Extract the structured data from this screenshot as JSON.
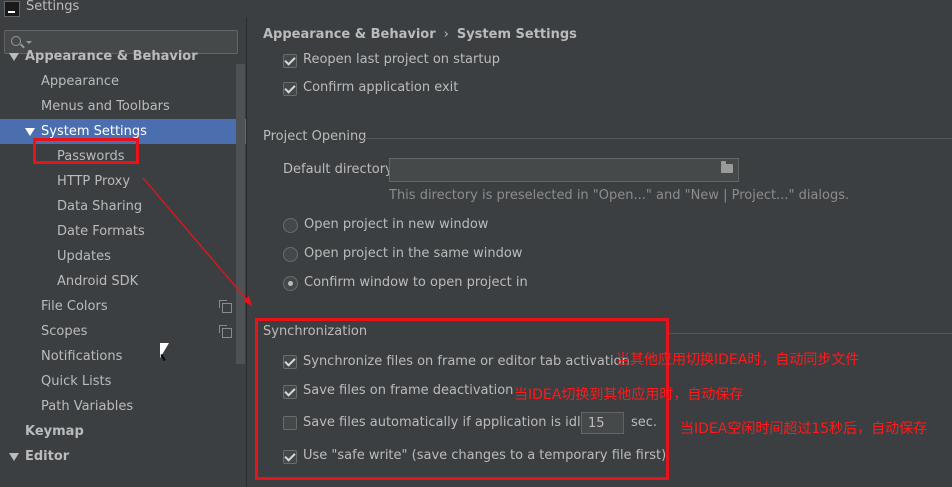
{
  "window": {
    "title": "Settings"
  },
  "search": {
    "placeholder": ""
  },
  "tree": {
    "items": [
      {
        "label": "Appearance & Behavior"
      },
      {
        "label": "Appearance"
      },
      {
        "label": "Menus and Toolbars"
      },
      {
        "label": "System Settings"
      },
      {
        "label": "Passwords"
      },
      {
        "label": "HTTP Proxy"
      },
      {
        "label": "Data Sharing"
      },
      {
        "label": "Date Formats"
      },
      {
        "label": "Updates"
      },
      {
        "label": "Android SDK"
      },
      {
        "label": "File Colors"
      },
      {
        "label": "Scopes"
      },
      {
        "label": "Notifications"
      },
      {
        "label": "Quick Lists"
      },
      {
        "label": "Path Variables"
      },
      {
        "label": "Keymap"
      },
      {
        "label": "Editor"
      }
    ]
  },
  "breadcrumb": {
    "parent": "Appearance & Behavior",
    "separator": "›",
    "current": "System Settings"
  },
  "startup": {
    "reopen": {
      "label": "Reopen last project on startup",
      "checked": true
    },
    "confirm_exit": {
      "label": "Confirm application exit",
      "checked": true
    }
  },
  "project_opening": {
    "title": "Project Opening",
    "default_dir_label": "Default directory:",
    "default_dir_value": "",
    "hint": "This directory is preselected in \"Open...\" and \"New | Project...\" dialogs.",
    "options": [
      {
        "label": "Open project in new window",
        "selected": false
      },
      {
        "label": "Open project in the same window",
        "selected": false
      },
      {
        "label": "Confirm window to open project in",
        "selected": true
      }
    ]
  },
  "sync": {
    "title": "Synchronization",
    "sync_files": {
      "label": "Synchronize files on frame or editor tab activation",
      "checked": true
    },
    "save_deactivation": {
      "label": "Save files on frame deactivation",
      "checked": true
    },
    "save_idle": {
      "label": "Save files automatically if application is idle for",
      "checked": false,
      "value": "15",
      "unit": "sec."
    },
    "safe_write": {
      "label": "Use \"safe write\" (save changes to a temporary file first)",
      "checked": true
    }
  },
  "annotations": {
    "note1": "当其他应用切换IDEA时，自动同步文件",
    "note2": "当IDEA切换到其他应用时，自动保存",
    "note3": "当IDEA空闲时间超过15秒后，自动保存"
  },
  "colors": {
    "annotation_red": "#e8131a",
    "selection_blue": "#4b6eaf",
    "background": "#3c3f41"
  }
}
